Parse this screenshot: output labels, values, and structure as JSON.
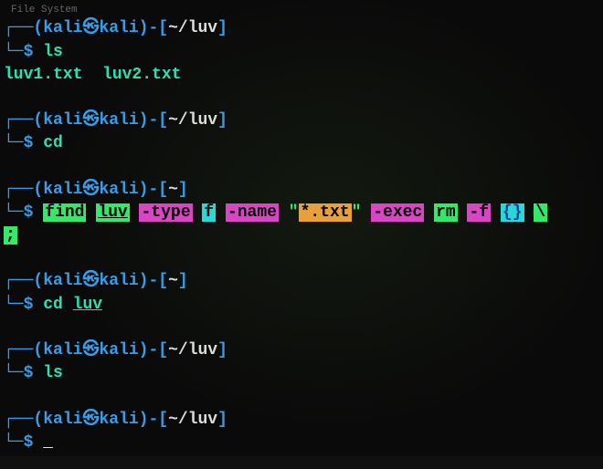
{
  "top_label": "File System",
  "prompt": {
    "user": "kali",
    "host": "kali",
    "at_glyph": "㉿"
  },
  "blocks": [
    {
      "path": "~/luv",
      "cmd_plain": "ls",
      "output": "luv1.txt  luv2.txt"
    },
    {
      "path": "~/luv",
      "cmd_plain": "cd",
      "output": ""
    },
    {
      "path": "~",
      "cmd_type": "find",
      "find": {
        "cmd": "find",
        "dir": "luv",
        "type_flag": "-type",
        "type_val": "f",
        "name_flag": "-name",
        "pattern_q": "\"",
        "pattern": "*.txt",
        "exec_flag": "-exec",
        "rm": "rm",
        "rm_flag": "-f",
        "braces": "{}",
        "bslash": "\\",
        "semi": ";"
      }
    },
    {
      "path": "~",
      "cmd_cd": {
        "cmd": "cd",
        "arg": "luv"
      }
    },
    {
      "path": "~/luv",
      "cmd_plain": "ls",
      "output": ""
    },
    {
      "path": "~/luv",
      "cmd_cursor": true
    }
  ],
  "cursor": "_",
  "box": {
    "top_left": "┌──",
    "bot_left": "└─"
  },
  "symbols": {
    "open_p": "(",
    "close_p": ")",
    "dash": "-",
    "open_b": "[",
    "close_b": "]",
    "dollar": "$"
  }
}
